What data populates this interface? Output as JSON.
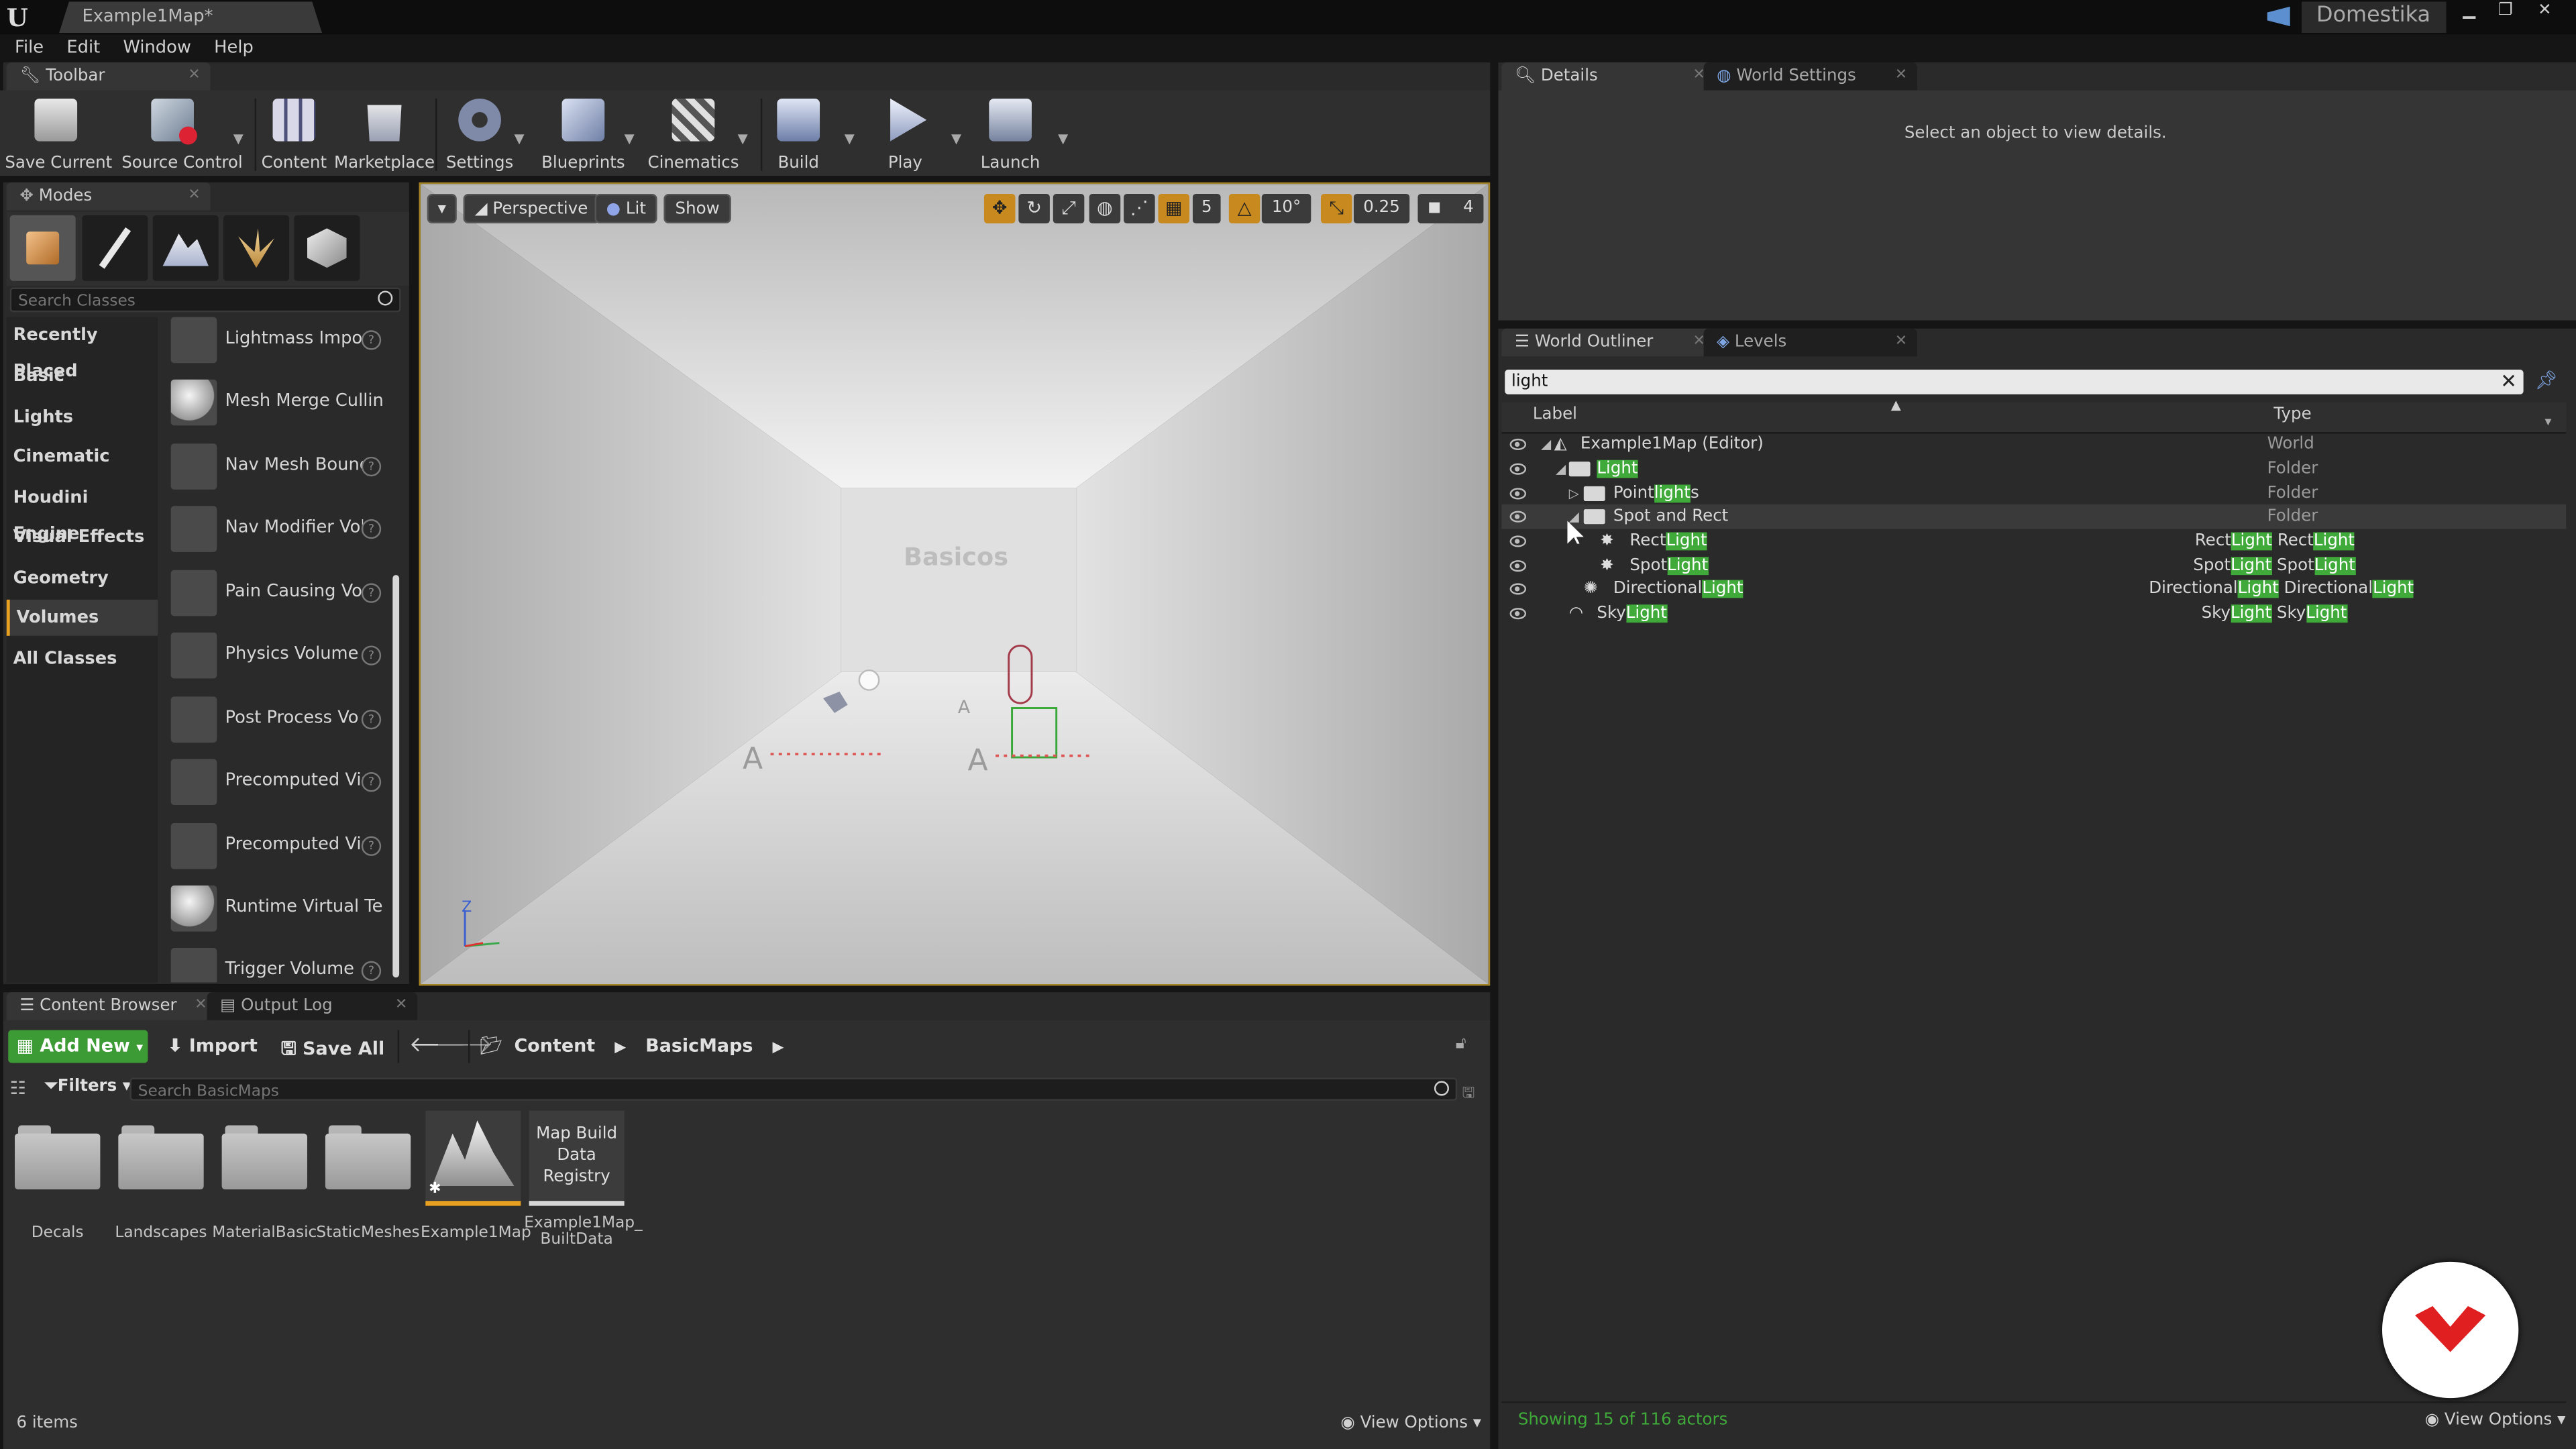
{
  "window": {
    "doc_tab": "Example1Map*",
    "user": "Domestika"
  },
  "menu": [
    "File",
    "Edit",
    "Window",
    "Help"
  ],
  "toolbar_panel": {
    "tab": "Toolbar",
    "buttons": [
      {
        "label": "Save Current"
      },
      {
        "label": "Source Control"
      },
      {
        "label": "Content"
      },
      {
        "label": "Marketplace"
      },
      {
        "label": "Settings"
      },
      {
        "label": "Blueprints"
      },
      {
        "label": "Cinematics"
      },
      {
        "label": "Build"
      },
      {
        "label": "Play"
      },
      {
        "label": "Launch"
      }
    ]
  },
  "modes": {
    "tab": "Modes",
    "search_placeholder": "Search Classes",
    "categories": [
      "Recently Placed",
      "Basic",
      "Lights",
      "Cinematic",
      "Houdini Engine",
      "Visual Effects",
      "Geometry",
      "Volumes",
      "All Classes"
    ],
    "selected_category": "Volumes",
    "items": [
      "Lightmass Impor",
      "Mesh Merge Culling",
      "Nav Mesh Bounc",
      "Nav Modifier Vol",
      "Pain Causing Vol",
      "Physics Volume",
      "Post Process Vo",
      "Precomputed Vis",
      "Precomputed Vis",
      "Runtime Virtual Text",
      "Trigger Volume"
    ]
  },
  "viewport": {
    "perspective": "Perspective",
    "lit": "Lit",
    "show": "Show",
    "grid_snap": "5",
    "rot_snap": "10°",
    "scale_snap": "0.25",
    "cam_speed": "4",
    "wall_text": "Basicos",
    "axis_z": "Z"
  },
  "details": {
    "tab": "Details",
    "tab2": "World Settings",
    "empty_msg": "Select an object to view details."
  },
  "outliner": {
    "tab": "World Outliner",
    "tab2": "Levels",
    "search_value": "light",
    "col_label": "Label",
    "col_type": "Type",
    "rows": [
      {
        "pre": "Example1Map (Editor)",
        "hl": "",
        "post": "",
        "type_pre": "World",
        "type_hl": "",
        "type_mid": "",
        "type_hl2": ""
      },
      {
        "pre": "",
        "hl": "Light",
        "post": "",
        "type_pre": "Folder",
        "type_hl": "",
        "type_mid": "",
        "type_hl2": ""
      },
      {
        "pre": "Point",
        "hl": "light",
        "post": "s",
        "type_pre": "Folder",
        "type_hl": "",
        "type_mid": "",
        "type_hl2": ""
      },
      {
        "pre": "Spot and Rect",
        "hl": "",
        "post": "",
        "type_pre": "Folder",
        "type_hl": "",
        "type_mid": "",
        "type_hl2": ""
      },
      {
        "pre": "Rect",
        "hl": "Light",
        "post": "",
        "type_pre": "Rect",
        "type_hl": "Light",
        "type_mid": " Rect",
        "type_hl2": "Light"
      },
      {
        "pre": "Spot",
        "hl": "Light",
        "post": "",
        "type_pre": "Spot",
        "type_hl": "Light",
        "type_mid": " Spot",
        "type_hl2": "Light"
      },
      {
        "pre": "Directional",
        "hl": "Light",
        "post": "",
        "type_pre": "Directional",
        "type_hl": "Light",
        "type_mid": " Directional",
        "type_hl2": "Light"
      },
      {
        "pre": "Sky",
        "hl": "Light",
        "post": "",
        "type_pre": "Sky",
        "type_hl": "Light",
        "type_mid": " Sky",
        "type_hl2": "Light"
      }
    ],
    "footer": "Showing 15 of 116 actors",
    "view_options": "View Options"
  },
  "content_browser": {
    "tab": "Content Browser",
    "tab2": "Output Log",
    "add_new": "Add New",
    "import": "Import",
    "save_all": "Save All",
    "path": [
      "Content",
      "BasicMaps"
    ],
    "filters": "Filters",
    "search_placeholder": "Search BasicMaps",
    "assets": [
      {
        "name": "Decals"
      },
      {
        "name": "Landscapes"
      },
      {
        "name": "MaterialBasic"
      },
      {
        "name": "StaticMeshes"
      },
      {
        "name": "Example1Map"
      },
      {
        "name": "Example1Map_ BuiltData",
        "thumb": "Map Build Data Registry"
      }
    ],
    "count": "6 items",
    "view_options": "View Options"
  },
  "colors": {
    "accent_green": "#3fa93a",
    "add_new_green": "#3d9b35",
    "selection_orange": "#e8a020",
    "domestika_red": "#e02020"
  }
}
